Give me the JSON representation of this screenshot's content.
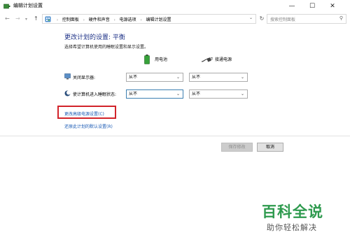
{
  "window": {
    "title": "编辑计划设置",
    "controls": {
      "minimize": "—",
      "maximize": "☐",
      "close": "✕"
    }
  },
  "address_bar": {
    "breadcrumbs": [
      "控制面板",
      "硬件和声音",
      "电源选项",
      "编辑计划设置"
    ],
    "search_placeholder": "搜索控制面板"
  },
  "main": {
    "heading": "更改计划的设置: 平衡",
    "subtitle": "选择希望计算机使用的睡眠设置和显示设置。",
    "columns": {
      "battery": "用电池",
      "plugged_in": "接通电源"
    },
    "rows": [
      {
        "label": "关闭显示器:",
        "icon": "monitor-icon",
        "battery_value": "从不",
        "plugged_value": "从不"
      },
      {
        "label": "使计算机进入睡眠状态:",
        "icon": "sleep-moon-icon",
        "battery_value": "从不",
        "plugged_value": "从不"
      }
    ],
    "links": {
      "advanced": "更改高级电源设置(C)",
      "restore": "还原此计划的默认设置(R)"
    }
  },
  "buttons": {
    "save": "保存修改",
    "cancel": "取消"
  },
  "watermark": {
    "title": "百科全说",
    "subtitle": "助你轻松解决"
  },
  "colors": {
    "heading": "#1e3287",
    "link": "#1b5bb5",
    "highlight": "#d2232a",
    "watermark": "#2e9a4e"
  }
}
